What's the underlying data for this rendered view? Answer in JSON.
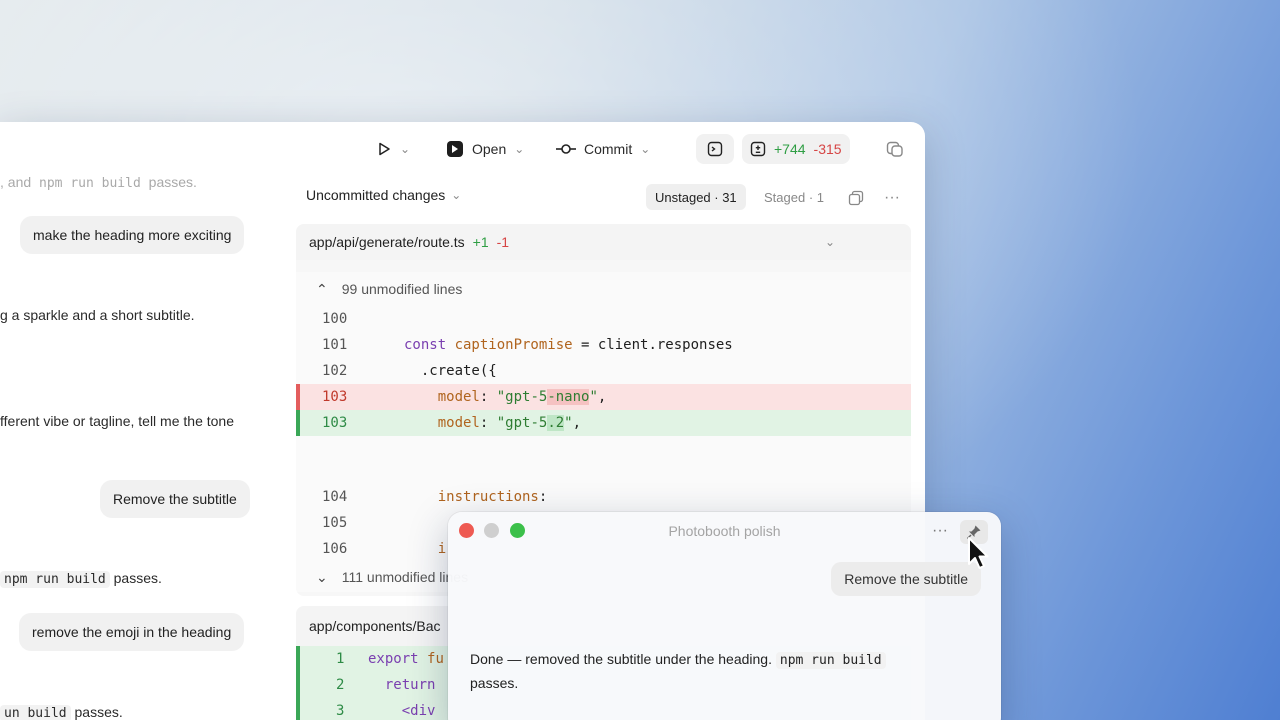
{
  "toolbar": {
    "open_label": "Open",
    "commit_label": "Commit",
    "additions": "+744",
    "deletions": "-315"
  },
  "chat": {
    "line1_prefix": ", and ",
    "line1_code": "npm run build",
    "line1_suffix": " passes.",
    "bubble1": "make the heading more exciting",
    "line2": "g a sparkle and a short subtitle.",
    "line3": "fferent vibe or tagline, tell me the tone",
    "bubble2": "Remove the subtitle",
    "line4_code": "npm run build",
    "line4_suffix": " passes.",
    "bubble3": "remove the emoji in the heading",
    "line5_code": "un build",
    "line5_suffix": " passes."
  },
  "diff": {
    "header": "Uncommitted changes",
    "unstaged": "Unstaged · 31",
    "staged": "Staged · 1",
    "file1": {
      "name": "app/api/generate/route.ts",
      "added": "+1",
      "removed": "-1",
      "fold_top": "99 unmodified lines",
      "fold_bottom": "111 unmodified lines",
      "lines": [
        {
          "n": "100",
          "code": ""
        },
        {
          "n": "101",
          "code_kw": "const ",
          "code_var": "captionPromise",
          "code_rest": " = client.responses"
        },
        {
          "n": "102",
          "code": "  .create({"
        },
        {
          "n": "103",
          "pre": "    ",
          "key": "model",
          "colon": ": ",
          "s1": "\"gpt-5",
          "hl": "-nano",
          "s2": "\"",
          "tail": ","
        },
        {
          "n": "103",
          "pre": "    ",
          "key": "model",
          "colon": ": ",
          "s1": "\"gpt-5",
          "hl": ".2",
          "s2": "\"",
          "tail": ","
        },
        {
          "n": "104",
          "pre": "    ",
          "key": "instructions",
          "tail": ":"
        },
        {
          "n": "105",
          "code": ""
        },
        {
          "n": "106",
          "code": "    i"
        }
      ]
    },
    "file2": {
      "name": "app/components/Bac",
      "lines": [
        {
          "n": "1",
          "kw": "export ",
          "rest": "fu"
        },
        {
          "n": "2",
          "kw": "  return",
          "rest": ""
        },
        {
          "n": "3",
          "kw": "",
          "rest": "    <div"
        }
      ]
    }
  },
  "mini": {
    "title": "Photobooth polish",
    "bubble": "Remove the subtitle",
    "body_prefix": "Done — removed the subtitle under the heading. ",
    "body_code": "npm run build",
    "body_suffix": "passes."
  },
  "colors": {
    "close": "#ee5a52",
    "minimize": "#cfcfcf",
    "zoom": "#3cc04a",
    "added": "#2f9e44",
    "removed": "#d64545"
  }
}
